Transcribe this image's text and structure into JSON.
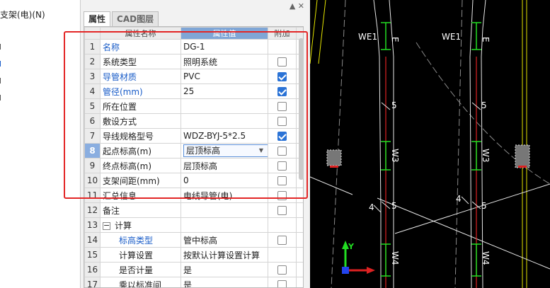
{
  "left_strip": {
    "items": [
      "支架(电)(N)"
    ]
  },
  "panel": {
    "tabs": [
      {
        "label": "属性",
        "active": true
      },
      {
        "label": "CAD图层",
        "active": false
      }
    ],
    "columns": {
      "name": "属性名称",
      "value": "属性值",
      "extra": "附加"
    },
    "rows": [
      {
        "no": "1",
        "name": "名称",
        "value": "DG-1",
        "blue": true,
        "check": null
      },
      {
        "no": "2",
        "name": "系统类型",
        "value": "照明系统",
        "blue": false,
        "check": false
      },
      {
        "no": "3",
        "name": "导管材质",
        "value": "PVC",
        "blue": true,
        "check": true
      },
      {
        "no": "4",
        "name": "管径(mm)",
        "value": "25",
        "blue": true,
        "check": true
      },
      {
        "no": "5",
        "name": "所在位置",
        "value": "",
        "blue": false,
        "check": false
      },
      {
        "no": "6",
        "name": "敷设方式",
        "value": "",
        "blue": false,
        "check": false
      },
      {
        "no": "7",
        "name": "导线规格型号",
        "value": "WDZ-BYJ-5*2.5",
        "blue": false,
        "check": true
      },
      {
        "no": "8",
        "name": "起点标高(m)",
        "value": "层顶标高",
        "blue": false,
        "check": false,
        "selected": true
      },
      {
        "no": "9",
        "name": "终点标高(m)",
        "value": "层顶标高",
        "blue": false,
        "check": false
      },
      {
        "no": "10",
        "name": "支架间距(mm)",
        "value": "0",
        "blue": false,
        "check": false
      },
      {
        "no": "11",
        "name": "汇总信息",
        "value": "电线导管(电)",
        "blue": false,
        "check": false
      },
      {
        "no": "12",
        "name": "备注",
        "value": "",
        "blue": false,
        "check": false
      },
      {
        "no": "13",
        "name": "计算",
        "value": "",
        "blue": false,
        "check": null,
        "group": true
      },
      {
        "no": "14",
        "name": "标高类型",
        "value": "管中标高",
        "blue": true,
        "check": false,
        "indent": true
      },
      {
        "no": "15",
        "name": "计算设置",
        "value": "按默认计算设置计算",
        "blue": false,
        "check": null,
        "indent": true
      },
      {
        "no": "16",
        "name": "是否计量",
        "value": "是",
        "blue": false,
        "check": false,
        "indent": true
      },
      {
        "no": "17",
        "name": "乘以标准间",
        "value": "是",
        "blue": false,
        "check": false,
        "indent": true
      }
    ]
  },
  "cad": {
    "labels": {
      "we1_a": "WE1",
      "we1_b": "WE1",
      "e_a": "E",
      "e_b": "E",
      "w3_a": "W3",
      "w3_b": "W3",
      "w4_a": "W4",
      "w4_b": "W4",
      "n5_a": "5",
      "n5_b": "5",
      "n5_c": "5",
      "n5_d": "5",
      "n4_a": "4",
      "n4_b": "4",
      "axis_y": "Y"
    },
    "colors": {
      "green": "#22dd22",
      "red": "#dd2222",
      "yellow": "#e6e600",
      "gray": "#8a8a8a"
    }
  }
}
